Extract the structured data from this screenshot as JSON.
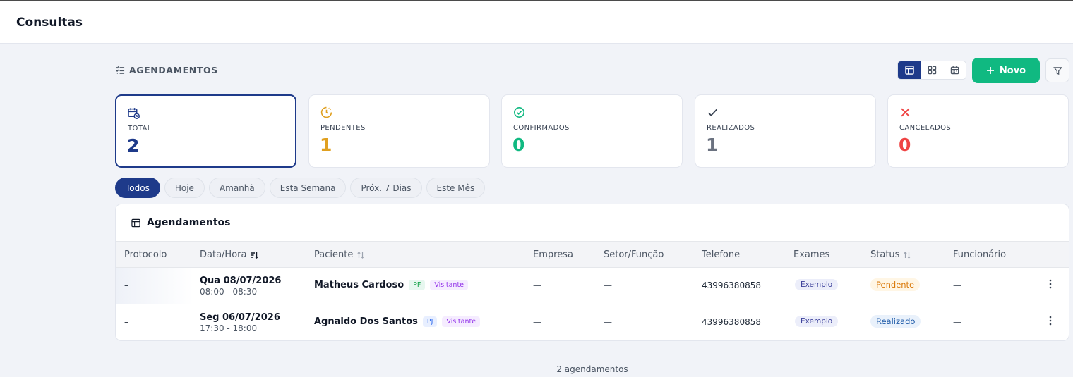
{
  "page": {
    "title": "Consultas"
  },
  "section": {
    "title": "AGENDAMENTOS"
  },
  "toolbar": {
    "views": [
      {
        "name": "table-view",
        "active": true
      },
      {
        "name": "grid-view",
        "active": false
      },
      {
        "name": "calendar-view",
        "active": false
      }
    ],
    "new_label": "Novo"
  },
  "stats": [
    {
      "label": "TOTAL",
      "value": "2",
      "color": "#1e3a8a",
      "icon": "calendar-clock-icon"
    },
    {
      "label": "PENDENTES",
      "value": "1",
      "color": "#e0a020",
      "icon": "clock-icon"
    },
    {
      "label": "CONFIRMADOS",
      "value": "0",
      "color": "#10b981",
      "icon": "check-circle-icon"
    },
    {
      "label": "REALIZADOS",
      "value": "1",
      "color": "#6b7280",
      "icon": "check-icon"
    },
    {
      "label": "CANCELADOS",
      "value": "0",
      "color": "#ef4444",
      "icon": "x-icon"
    }
  ],
  "filters": [
    "Todos",
    "Hoje",
    "Amanhã",
    "Esta Semana",
    "Próx. 7 Dias",
    "Este Mês"
  ],
  "active_filter": "Todos",
  "table": {
    "title": "Agendamentos",
    "columns": [
      "Protocolo",
      "Data/Hora",
      "Paciente",
      "Empresa",
      "Setor/Função",
      "Telefone",
      "Exames",
      "Status",
      "Funcionário"
    ],
    "rows": [
      {
        "protocolo": "–",
        "date": "Qua 08/07/2026",
        "time": "08:00 - 08:30",
        "paciente": "Matheus Cardoso",
        "tipo": "PF",
        "categoria": "Visitante",
        "empresa": "—",
        "setor": "—",
        "telefone": "43996380858",
        "exame": "Exemplo",
        "status": "Pendente",
        "funcionario": "—"
      },
      {
        "protocolo": "–",
        "date": "Seg 06/07/2026",
        "time": "17:30 - 18:00",
        "paciente": "Agnaldo Dos Santos",
        "tipo": "PJ",
        "categoria": "Visitante",
        "empresa": "—",
        "setor": "—",
        "telefone": "43996380858",
        "exame": "Exemplo",
        "status": "Realizado",
        "funcionario": "—"
      }
    ]
  },
  "footer": {
    "count_text": "2 agendamentos"
  },
  "colors": {
    "primary": "#1e3a8a",
    "accent_green": "#10b981",
    "pending": "#d97706",
    "cancel": "#ef4444"
  }
}
